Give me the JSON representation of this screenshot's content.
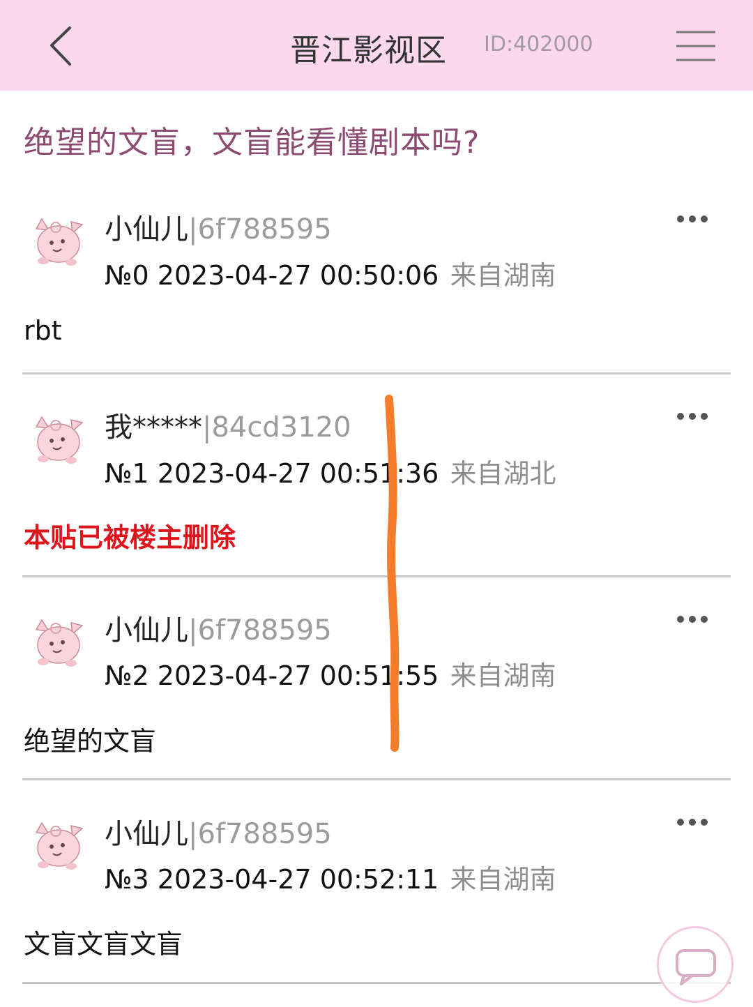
{
  "header": {
    "title": "晋江影视区",
    "board_id": "ID:402000"
  },
  "thread": {
    "title": "绝望的文盲，文盲能看懂剧本吗?"
  },
  "posts": [
    {
      "username": "小仙儿",
      "user_id": "|6f788595",
      "floor_time": "№0  2023-04-27 00:50:06",
      "location": "来自湖南",
      "content": "rbt"
    },
    {
      "username": "我*****",
      "user_id": "|84cd3120",
      "floor_time": "№1  2023-04-27 00:51:36",
      "location": "来自湖北",
      "content": "本贴已被楼主删除"
    },
    {
      "username": "小仙儿",
      "user_id": "|6f788595",
      "floor_time": "№2  2023-04-27 00:51:55",
      "location": "来自湖南",
      "content": "绝望的文盲"
    },
    {
      "username": "小仙儿",
      "user_id": "|6f788595",
      "floor_time": "№3  2023-04-27 00:52:11",
      "location": "来自湖南",
      "content": "文盲文盲文盲"
    }
  ],
  "colors": {
    "header_bg": "#fbd8ec",
    "title_color": "#8c4a70",
    "deleted_color": "#e0141b",
    "annotation_line": "#f57c2a"
  },
  "icons": {
    "back": "chevron-left-icon",
    "menu": "hamburger-menu-icon",
    "more": "more-dots-icon",
    "avatar": "pink-creature-avatar-icon",
    "chat": "chat-bubble-icon"
  }
}
